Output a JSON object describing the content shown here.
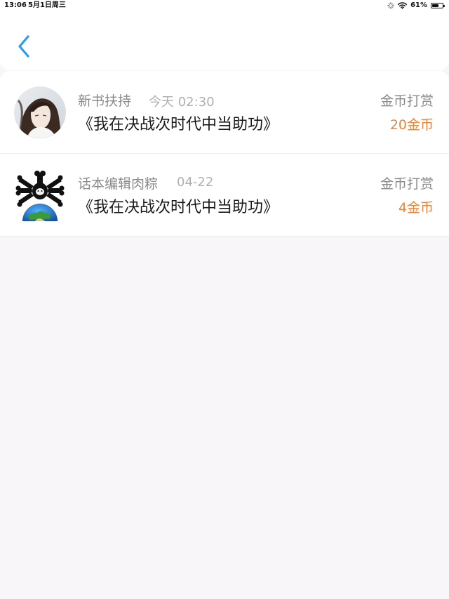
{
  "status_bar": {
    "time": "13:06",
    "date": "5月1日周三",
    "battery_percent": "61%",
    "battery_level": 0.61,
    "icons": [
      "loading-icon",
      "wifi-icon",
      "battery-icon"
    ]
  },
  "nav": {
    "back_icon": "chevron-left-icon",
    "accent_color": "#2d9cf0"
  },
  "records": [
    {
      "user": "新书扶持",
      "time": "今天 02:30",
      "book": "《我在决战次时代中当助功》",
      "type": "金币打赏",
      "amount": "20金币"
    },
    {
      "user": "话本编辑肉粽",
      "time": "04-22",
      "book": "《我在决战次时代中当助功》",
      "type": "金币打赏",
      "amount": "4金币"
    }
  ],
  "colors": {
    "amount": "#e8863e",
    "muted": "#8a8a8a",
    "background": "#f8f6f8"
  }
}
